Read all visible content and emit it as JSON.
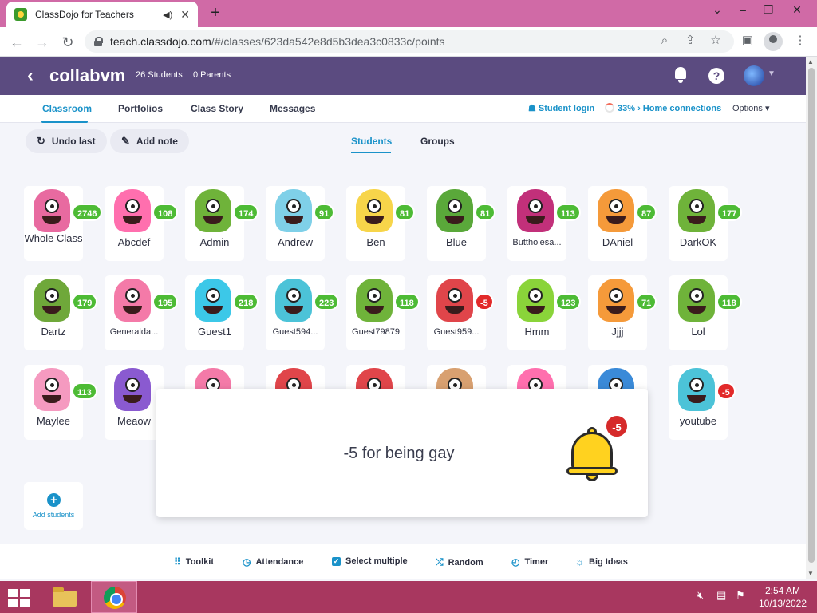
{
  "browser": {
    "tab_title": "ClassDojo for Teachers",
    "url_host": "teach.classdojo.com",
    "url_path": "/#/classes/623da542e8d5b3dea3c0833c/points"
  },
  "header": {
    "class_name": "collabvm",
    "students_count": "26 Students",
    "parents_count": "0 Parents"
  },
  "subnav": {
    "tabs": [
      "Classroom",
      "Portfolios",
      "Class Story",
      "Messages"
    ],
    "student_login": "Student login",
    "home_connections": "33% › Home connections",
    "options": "Options"
  },
  "actions": {
    "undo": "Undo last",
    "add_note": "Add note",
    "view_tabs": [
      "Students",
      "Groups"
    ]
  },
  "students": [
    {
      "name": "Whole Class",
      "points": "2746",
      "color": "#e86aa0"
    },
    {
      "name": "Abcdef",
      "points": "108",
      "color": "#ff6fae"
    },
    {
      "name": "Admin",
      "points": "174",
      "color": "#6fb33a"
    },
    {
      "name": "Andrew",
      "points": "91",
      "color": "#7fd0e8"
    },
    {
      "name": "Ben",
      "points": "81",
      "color": "#f7d54a"
    },
    {
      "name": "Blue",
      "points": "81",
      "color": "#5aa83a"
    },
    {
      "name": "Buttholesa...",
      "points": "113",
      "color": "#c2307a"
    },
    {
      "name": "DAniel",
      "points": "87",
      "color": "#f59a3a"
    },
    {
      "name": "DarkOK",
      "points": "177",
      "color": "#6fb33a"
    },
    {
      "name": "Dartz",
      "points": "179",
      "color": "#6fa83a"
    },
    {
      "name": "Generalda...",
      "points": "195",
      "color": "#f47aa8"
    },
    {
      "name": "Guest1",
      "points": "218",
      "color": "#3cc8e8"
    },
    {
      "name": "Guest594...",
      "points": "223",
      "color": "#4cc3d8"
    },
    {
      "name": "Guest79879",
      "points": "118",
      "color": "#6fb33a"
    },
    {
      "name": "Guest959...",
      "points": "-5",
      "color": "#e0454a"
    },
    {
      "name": "Hmm",
      "points": "123",
      "color": "#8ad43a"
    },
    {
      "name": "Jjjj",
      "points": "71",
      "color": "#f59a3a"
    },
    {
      "name": "Lol",
      "points": "118",
      "color": "#6fb33a"
    },
    {
      "name": "Maylee",
      "points": "113",
      "color": "#f59ac0"
    },
    {
      "name": "Meaow",
      "points": "",
      "color": "#8a5ad0"
    },
    {
      "name": "",
      "points": "",
      "color": "#f47aa8"
    },
    {
      "name": "",
      "points": "",
      "color": "#e0454a"
    },
    {
      "name": "",
      "points": "",
      "color": "#e0454a"
    },
    {
      "name": "",
      "points": "",
      "color": "#d8a070"
    },
    {
      "name": "",
      "points": "",
      "color": "#ff6fae"
    },
    {
      "name": "",
      "points": "",
      "color": "#3a8ad8"
    },
    {
      "name": "youtube",
      "points": "-5",
      "color": "#4cc3d8"
    }
  ],
  "add_students": "Add students",
  "popup": {
    "message": "-5 for being gay",
    "badge": "-5"
  },
  "toolbar": [
    "Toolkit",
    "Attendance",
    "Select multiple",
    "Random",
    "Timer",
    "Big Ideas"
  ],
  "taskbar": {
    "time": "2:54 AM",
    "date": "10/13/2022"
  }
}
